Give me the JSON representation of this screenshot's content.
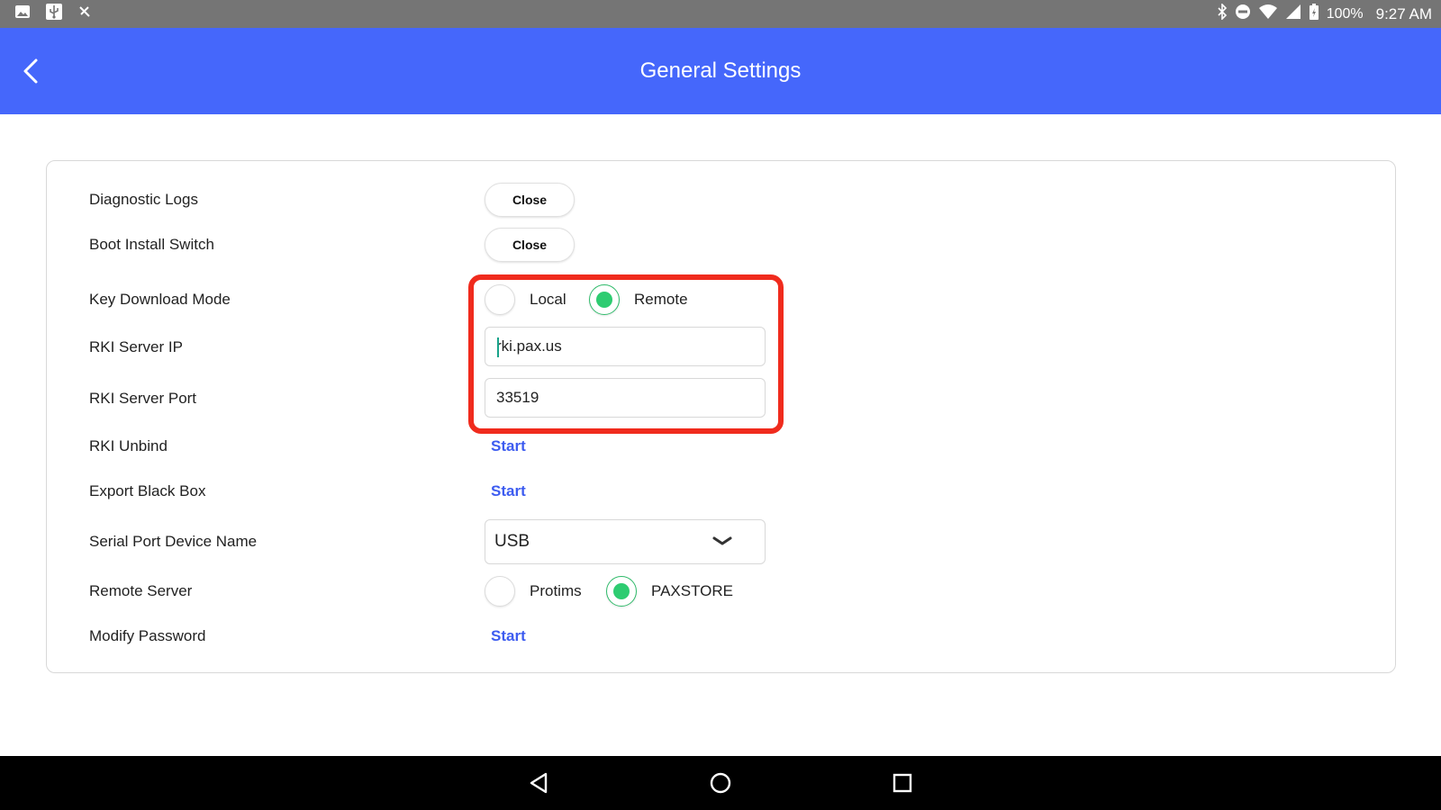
{
  "status_bar": {
    "battery": "100%",
    "time": "9:27 AM"
  },
  "header": {
    "title": "General Settings"
  },
  "settings": {
    "diagnostic_logs": {
      "label": "Diagnostic Logs",
      "toggle": "Close"
    },
    "boot_install_switch": {
      "label": "Boot Install Switch",
      "toggle": "Close"
    },
    "key_download_mode": {
      "label": "Key Download Mode",
      "options": [
        "Local",
        "Remote"
      ],
      "selected": "Remote"
    },
    "rki_server_ip": {
      "label": "RKI Server IP",
      "value": "rki.pax.us"
    },
    "rki_server_port": {
      "label": "RKI Server Port",
      "value": "33519"
    },
    "rki_unbind": {
      "label": "RKI Unbind",
      "action": "Start"
    },
    "export_black_box": {
      "label": "Export Black Box",
      "action": "Start"
    },
    "serial_port_device_name": {
      "label": "Serial Port Device Name",
      "value": "USB"
    },
    "remote_server": {
      "label": "Remote Server",
      "options": [
        "Protims",
        "PAXSTORE"
      ],
      "selected": "PAXSTORE"
    },
    "modify_password": {
      "label": "Modify Password",
      "action": "Start"
    }
  },
  "colors": {
    "app_bar": "#4567fb",
    "status_bar": "#757575",
    "radio_checked": "#2ecc71",
    "link": "#3d5cf0",
    "highlight": "#f02b1d"
  }
}
